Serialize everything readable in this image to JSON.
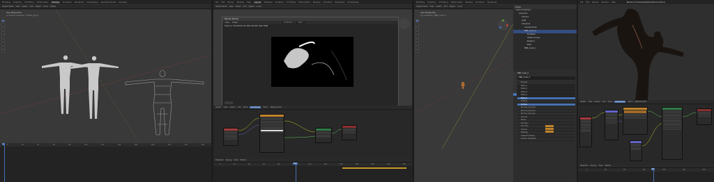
{
  "screens": [
    {
      "id": "s1",
      "menu": [
        "Modeling",
        "Sculpting",
        "UV Editing",
        "Texture Paint",
        "Shading",
        "Animation",
        "Rendering",
        "Compositing",
        "Geometry Nodes",
        "Scripting"
      ],
      "active_menu": 4,
      "header": [
        "Object Mode",
        "View",
        "Select",
        "Add",
        "Object",
        "Local",
        "Global"
      ],
      "viewport": {
        "label": "User Perspective",
        "sublabel": "(1) Scene Collection | T-Pose_Jimmy"
      },
      "timeline": {
        "ticks": [
          "0",
          "10",
          "20",
          "30",
          "40",
          "50",
          "60",
          "70",
          "80",
          "90",
          "100",
          "110",
          "120",
          "130",
          "140",
          "150",
          "160",
          "170",
          "180",
          "190",
          "200",
          "210",
          "220",
          "230",
          "240"
        ],
        "current_frame": "1"
      }
    },
    {
      "id": "s2",
      "menu": [
        "File",
        "Edit",
        "Render",
        "Window",
        "Help",
        "Layout",
        "Modeling",
        "Sculpting",
        "UV Editing",
        "Texture Paint",
        "Shading",
        "Animation",
        "Rendering",
        "Compositing"
      ],
      "active_menu": 5,
      "header": [
        "Object Mode",
        "View",
        "Select",
        "Add",
        "Object",
        "Local"
      ],
      "render_window": {
        "title": "Blender Render",
        "menu": [
          "View",
          "Image"
        ],
        "status": "Frame:1 | Time:00:02.79 | Mem:167.9M, Peak 349M",
        "view_label": "Combined",
        "slot": "Slot 1"
      },
      "node_header": [
        "Object",
        "View",
        "Select",
        "Add",
        "Node",
        "Use Nodes",
        "Slot 1",
        "Material.001"
      ],
      "timeline": {
        "ticks": [
          "0",
          "10",
          "20",
          "30",
          "40",
          "50",
          "60",
          "70",
          "80",
          "90",
          "100",
          "110",
          "120",
          "130",
          "140",
          "150",
          "160",
          "170",
          "180",
          "190",
          "200",
          "210",
          "220",
          "230",
          "240",
          "250"
        ],
        "current_frame": "102",
        "menu": [
          "Playback",
          "Keying",
          "View",
          "Marker"
        ]
      }
    },
    {
      "id": "s3",
      "menu": [
        "Modeling",
        "Sculpting",
        "UV Editing",
        "Texture Paint",
        "Shading",
        "Animation",
        "Rendering"
      ],
      "header": [
        "Object Mode",
        "View",
        "Select",
        "Add",
        "Object",
        "Local"
      ],
      "viewport": {
        "label": "User Perspective",
        "sublabel": "(1) Collection | BBB_mesh_0"
      },
      "outliner": {
        "title": "Scene",
        "items": [
          "Scene Collection",
          "Collection",
          "Camera",
          "Light",
          "Armature",
          "Armature.001",
          "BBB_mesh_0",
          "Modifiers",
          "Vertex Groups",
          "Material",
          "Pose",
          "BBB_mesh_1"
        ],
        "selected": 6
      },
      "properties": {
        "object_name": "BBB_mesh_0",
        "material_name": "BBB_mesh_0",
        "sections": [
          "Preview",
          "Surface",
          "Principled BSDF",
          "Subsurface",
          "Specular",
          "Transmission",
          "Coat",
          "Sheen",
          "Emission",
          "Thin Film",
          "Volume",
          "Settings",
          "Line Art",
          "Viewport Display",
          "Custom Properties"
        ],
        "slots": [
          "Metal_1",
          "Metal_2",
          "Metal_3",
          "Metal_4",
          "Metal_5"
        ],
        "surface_rows": [
          "Surface",
          "Normal_1_B_pass",
          "Normal_2_B_pass",
          "Normal_3_B_pass"
        ]
      }
    },
    {
      "id": "s4",
      "menu": [
        "File",
        "Edit",
        "Render",
        "Window",
        "Help"
      ],
      "title": "Blender [C:\\Users\\Ji\\Desktop\\Dance.blend]",
      "node_header": [
        "Object",
        "View",
        "Select",
        "Add",
        "Node",
        "Use Nodes",
        "Slot 1",
        "Material.001"
      ],
      "timeline": {
        "ticks": [
          "0",
          "10",
          "20",
          "30",
          "40",
          "50",
          "60",
          "70",
          "80",
          "90",
          "100",
          "110",
          "120",
          "130",
          "140",
          "150",
          "160",
          "170",
          "180",
          "190",
          "200",
          "210",
          "220",
          "230",
          "240",
          "250"
        ],
        "current_frame": "81",
        "menu": [
          "Playback",
          "Keying",
          "View",
          "Marker"
        ]
      }
    }
  ],
  "colors": {
    "accent": "#4772b3",
    "node_shader": "#2e7a45",
    "node_texture": "#c2842a",
    "node_vector": "#6363c7",
    "node_output": "#8a2f2f",
    "node_input": "#a33b3b"
  }
}
